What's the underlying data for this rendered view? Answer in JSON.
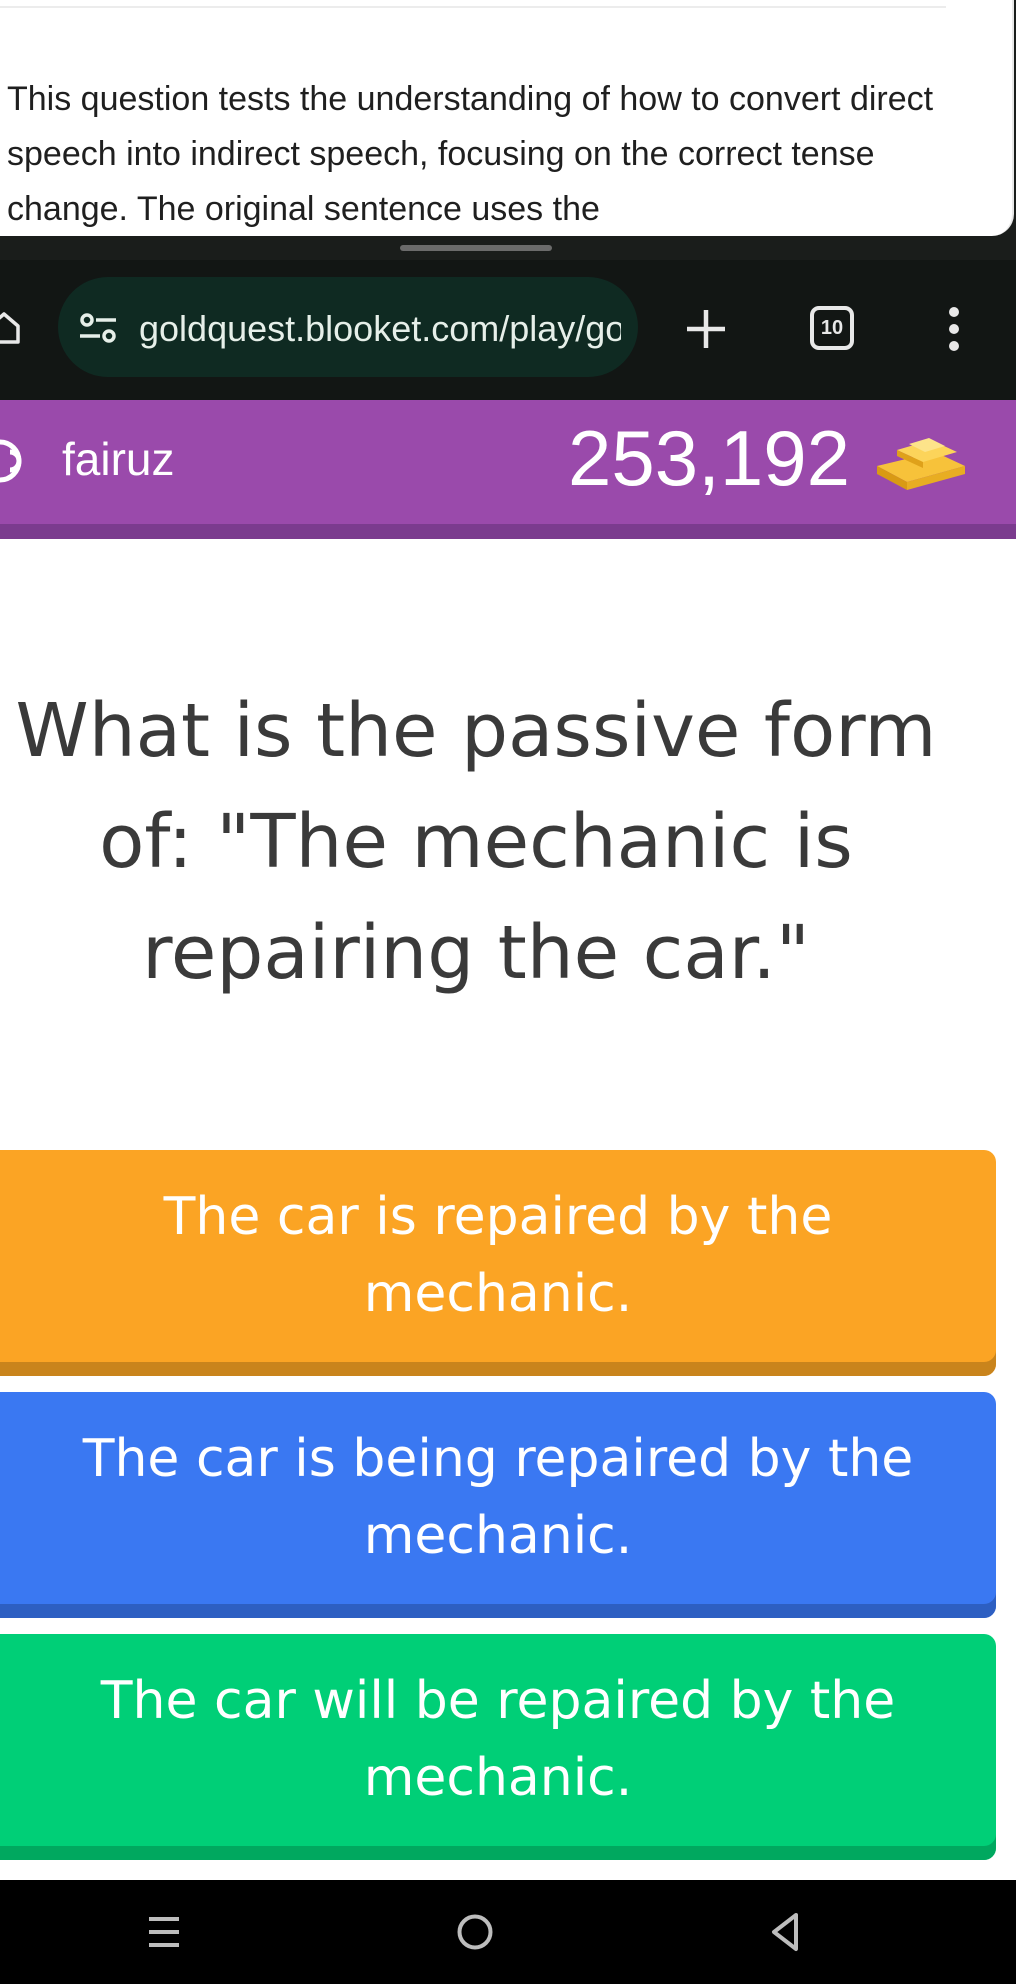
{
  "explanation_card": {
    "text": "This question tests the understanding of how to convert direct speech into indirect speech, focusing on the correct tense change. The original sentence uses the"
  },
  "browser": {
    "url": "goldquest.blooket.com/play/gold",
    "tab_count": "10"
  },
  "game_header": {
    "player_name": "fairuz",
    "gold": "253,192"
  },
  "question": {
    "text": "What is the passive form of: \"The mechanic is repairing the car.\""
  },
  "answers": [
    {
      "text": "The car is repaired by the mechanic.",
      "color": "#fba424"
    },
    {
      "text": "The car is being repaired by the mechanic.",
      "color": "#3a78f2"
    },
    {
      "text": "The car will be repaired by the mechanic.",
      "color": "#00cf77"
    }
  ],
  "icons": {
    "home": "home-icon",
    "site_settings": "tune-icon",
    "new_tab": "plus-icon",
    "tabs": "tab-switcher-icon",
    "menu": "more-vert-icon",
    "player": "player-icon",
    "gold": "gold-bars-icon",
    "nav_recents": "recents-icon",
    "nav_home": "circle-home-icon",
    "nav_back": "back-triangle-icon"
  },
  "colors": {
    "header_purple": "#9a4aab",
    "browser_dark": "#121614"
  }
}
